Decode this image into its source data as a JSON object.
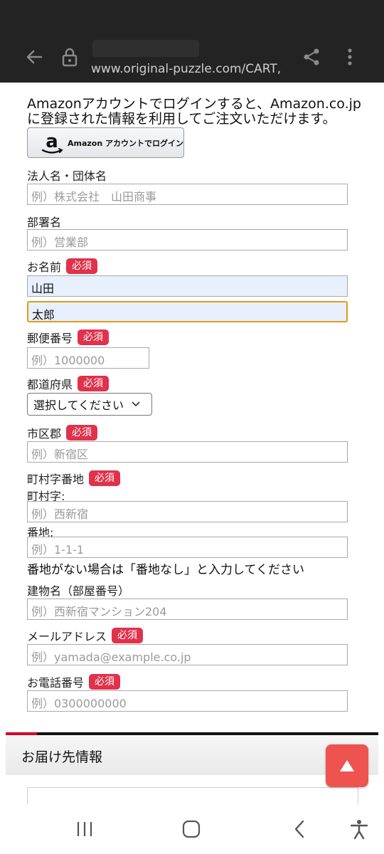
{
  "browser": {
    "url": "www.original-puzzle.com/CART,"
  },
  "intro_text": "Amazonアカウントでログインすると、Amazon.co.jpに登録された情報を利用してご注文いただけます。",
  "amazon_login": {
    "label": "Amazon アカウントでログイン"
  },
  "required_badge": "必須",
  "form": {
    "company": {
      "label": "法人名・団体名",
      "placeholder": "例）株式会社　山田商事"
    },
    "department": {
      "label": "部署名",
      "placeholder": "例）営業部"
    },
    "name": {
      "label": "お名前",
      "last_value": "山田",
      "first_value": "太郎"
    },
    "postal": {
      "label": "郵便番号",
      "placeholder": "例）1000000"
    },
    "prefecture": {
      "label": "都道府県",
      "selected": "選択してください"
    },
    "city": {
      "label": "市区郡",
      "placeholder": "例）新宿区"
    },
    "address": {
      "label": "町村字番地",
      "town_label": "町村字:",
      "town_placeholder": "例）西新宿",
      "number_label": "番地:",
      "number_placeholder": "例）1-1-1",
      "note": "番地がない場合は「番地なし」と入力してください"
    },
    "building": {
      "label": "建物名（部屋番号）",
      "placeholder": "例）西新宿マンション204"
    },
    "email": {
      "label": "メールアドレス",
      "placeholder": "例）yamada@example.co.jp"
    },
    "phone": {
      "label": "お電話番号",
      "placeholder": "例）0300000000"
    }
  },
  "delivery_section": {
    "title": "お届け先情報"
  },
  "colors": {
    "accent_red": "#e0324b",
    "focus_orange": "#e39a16",
    "autofill_blue": "#e8f0fe",
    "to_top_button": "#ef5350"
  },
  "icons": [
    "back-arrow-icon",
    "lock-icon",
    "share-icon",
    "more-vert-icon",
    "amazon-logo-icon",
    "chevron-down-icon",
    "triangle-up-icon",
    "recent-apps-icon",
    "home-icon",
    "back-icon",
    "accessibility-icon"
  ]
}
